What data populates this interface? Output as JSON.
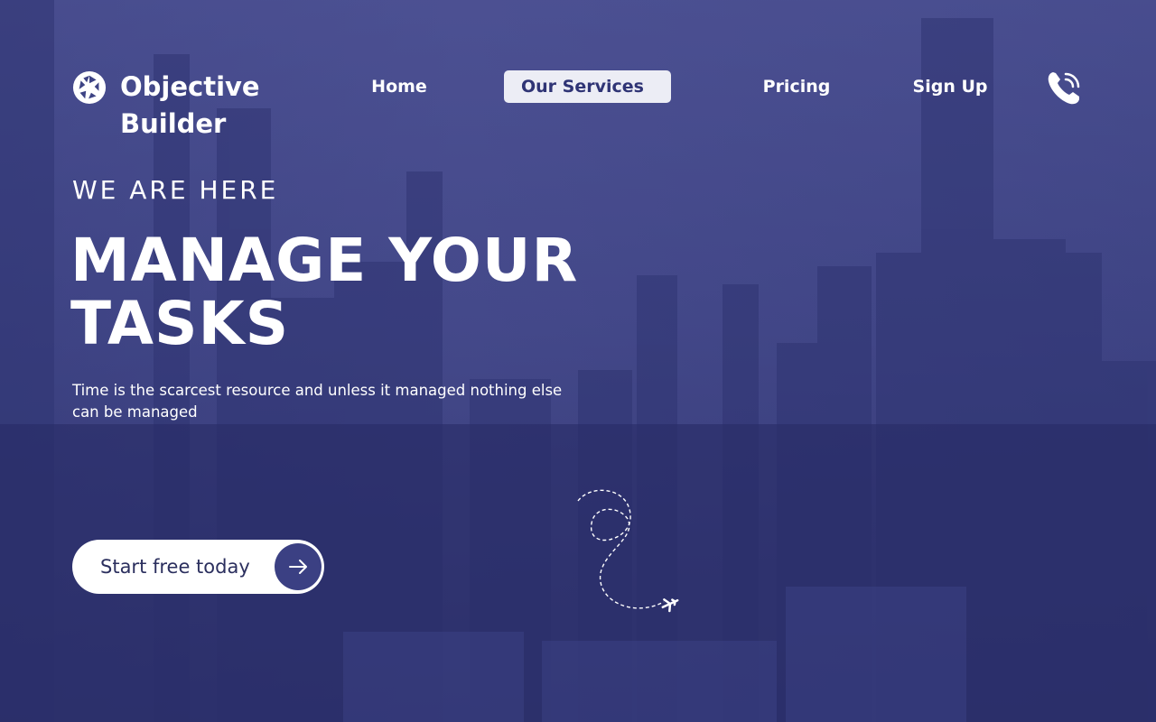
{
  "brand": {
    "name": "Objective Builder",
    "icon": "aperture-icon"
  },
  "nav": {
    "items": [
      {
        "label": "Home"
      },
      {
        "label": "Our Services",
        "active": true
      },
      {
        "label": "Pricing"
      },
      {
        "label": "Sign Up"
      }
    ],
    "phone_icon": "phone-call-icon"
  },
  "hero": {
    "eyebrow": "WE ARE HERE",
    "headline": "MANAGE YOUR TASKS",
    "subtext": "Time is the  scarcest resource  and unless it  managed  nothing else can be  managed",
    "cta_label": "Start free today",
    "cta_icon": "arrow-right-icon",
    "decoration_icon": "airplane-icon"
  },
  "colors": {
    "overlay": "#3d4384",
    "active_nav_bg": "#ecedf5",
    "active_nav_text": "#2f3475",
    "cta_bg": "#ffffff",
    "cta_arrow_bg": "#3b4083"
  }
}
